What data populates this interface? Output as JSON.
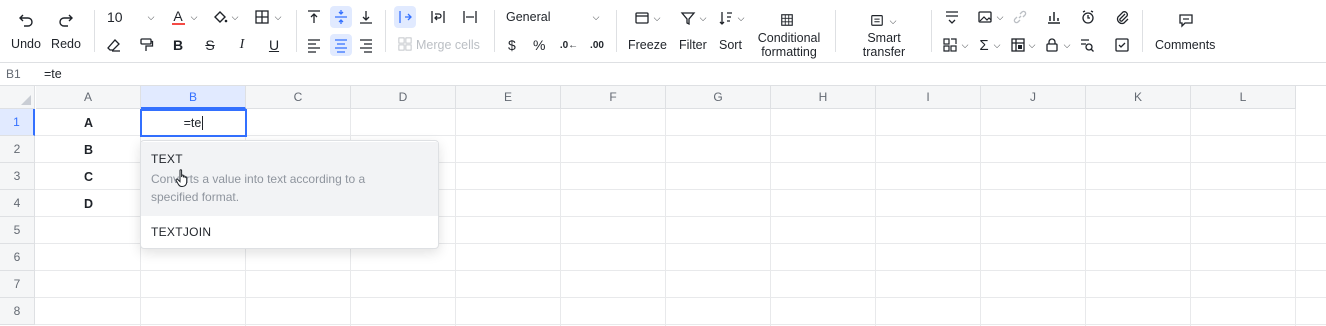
{
  "toolbar": {
    "undo": "Undo",
    "redo": "Redo",
    "font_size": "10",
    "number_format": "General",
    "merge_cells": "Merge cells",
    "currency": "$",
    "percent": "%",
    "freeze": "Freeze",
    "filter": "Filter",
    "sort": "Sort",
    "conditional_formatting_line1": "Conditional",
    "conditional_formatting_line2": "formatting",
    "smart_transfer_line1": "Smart",
    "smart_transfer_line2": "transfer",
    "comments": "Comments",
    "accent_color": "#3370ff",
    "font_color_bar": "#f54a45"
  },
  "formula_bar": {
    "cell_ref": "B1",
    "formula": "=te"
  },
  "grid": {
    "columns": [
      "A",
      "B",
      "C",
      "D",
      "E",
      "F",
      "G",
      "H",
      "I",
      "J",
      "K",
      "L"
    ],
    "rows": [
      "1",
      "2",
      "3",
      "4",
      "5",
      "6",
      "7",
      "8"
    ],
    "selected_column": "B",
    "selected_row": "1",
    "column_a_values": [
      "A",
      "B",
      "C",
      "D"
    ],
    "active_cell_value": "=te"
  },
  "autocomplete": {
    "items": [
      {
        "name": "TEXT",
        "description": "Converts a value into text according to a specified format."
      },
      {
        "name": "TEXTJOIN",
        "description": ""
      }
    ]
  }
}
